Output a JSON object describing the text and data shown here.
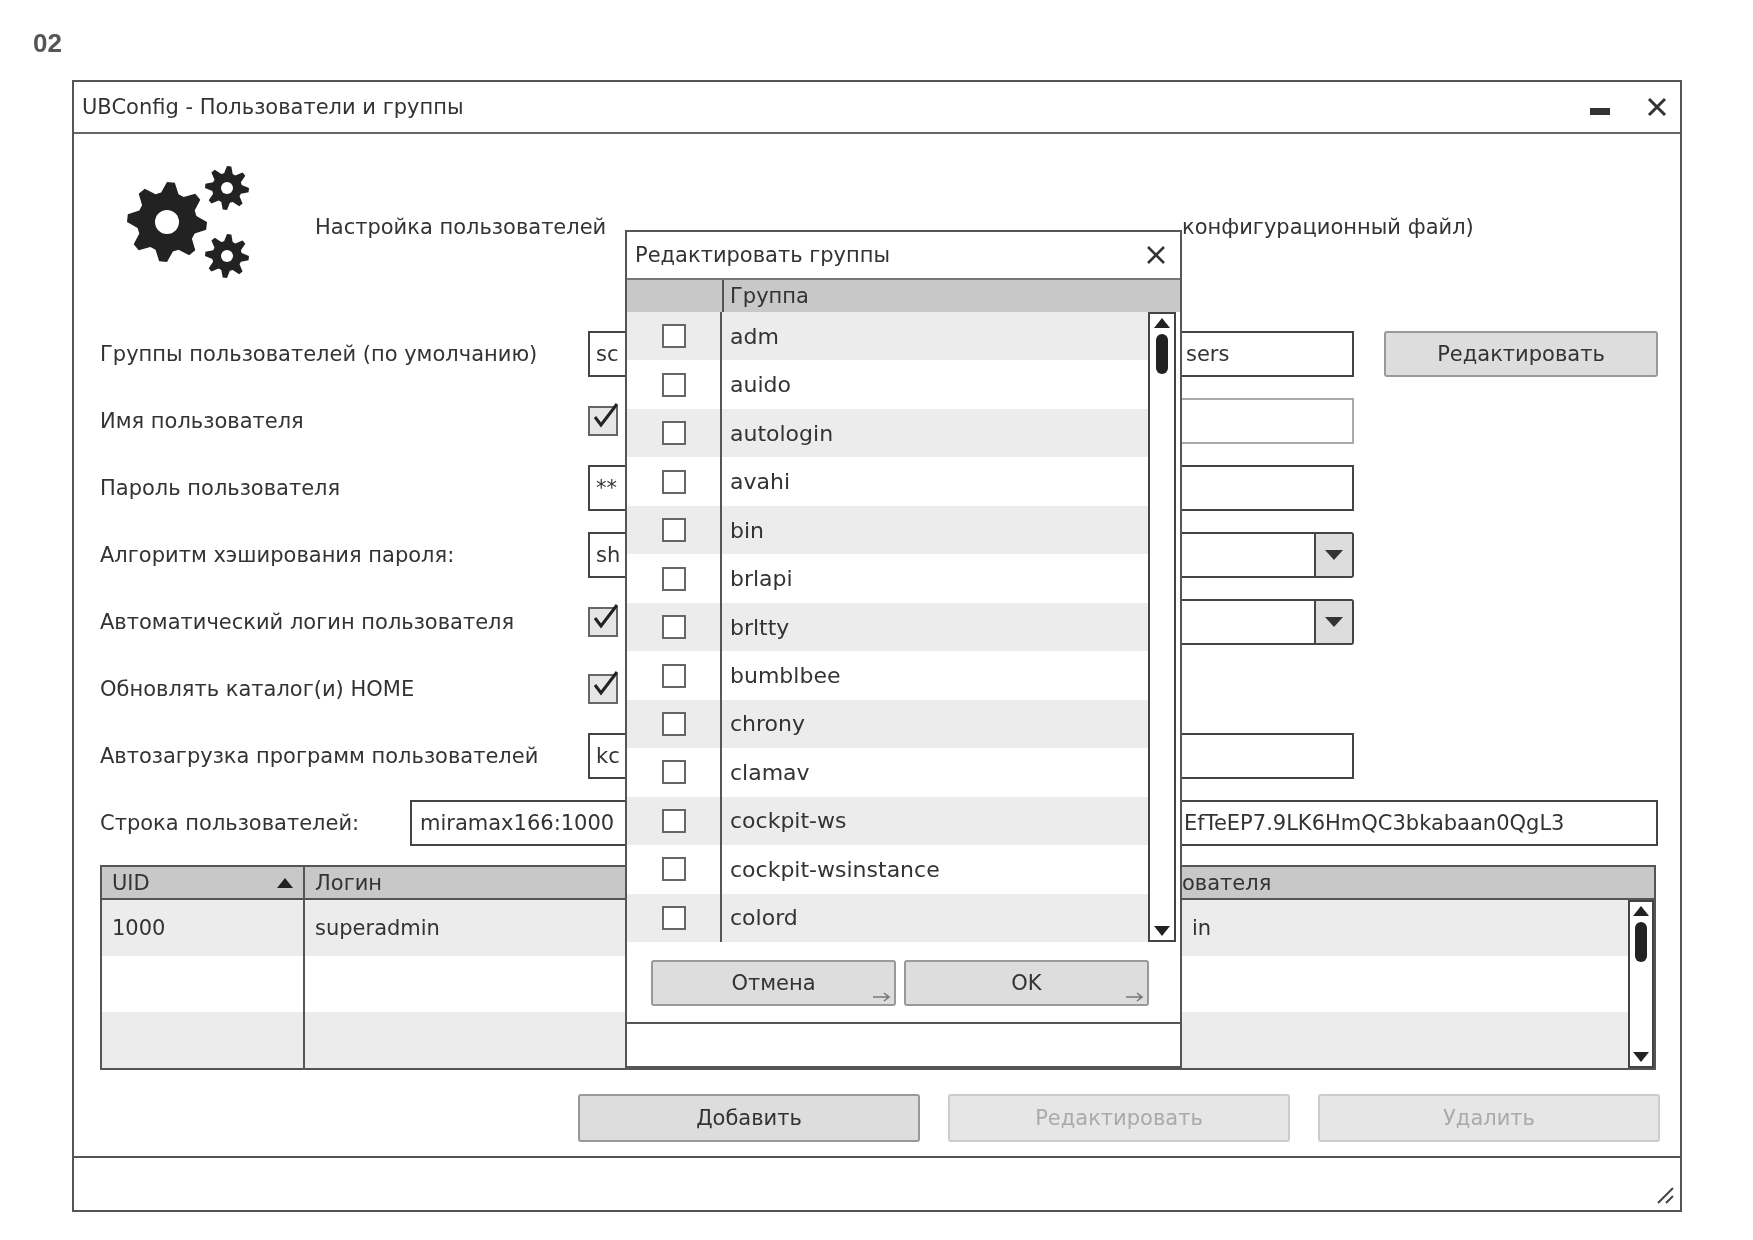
{
  "page_label": "02",
  "window": {
    "title": "UBConfig - Пользователи и группы"
  },
  "description": {
    "left": "Настройка пользователей",
    "right": "конфигурационный файл)"
  },
  "form_rows": [
    {
      "kind": "field",
      "label": "Группы пользователей (по умолчанию)",
      "value_left": "sc",
      "value_right": "sers",
      "button": "Редактировать"
    },
    {
      "kind": "check_field",
      "label": "Имя пользователя",
      "checked": true,
      "disabled": true
    },
    {
      "kind": "field",
      "label": "Пароль пользователя",
      "value_left": "**"
    },
    {
      "kind": "combo",
      "label": "Алгоритм хэширования пароля:",
      "value_left": "sh"
    },
    {
      "kind": "check_combo",
      "label": "Автоматический логин пользователя",
      "checked": true
    },
    {
      "kind": "check",
      "label": "Обновлять каталог(и) HOME",
      "checked": true
    },
    {
      "kind": "field",
      "label": "Автозагрузка программ пользователей",
      "value_left": "kc"
    }
  ],
  "user_string": {
    "label": "Строка пользователей:",
    "value_left": "miramax166:1000",
    "value_right": "EfTeEP7.9LK6HmQC3bkabaan0QgL3"
  },
  "table": {
    "columns": [
      {
        "label": "UID",
        "sorted": true
      },
      {
        "label": "Логин",
        "sorted": false
      },
      {
        "label": "ователя",
        "sorted": false
      }
    ],
    "rows": [
      {
        "cells": [
          "1000",
          "superadmin",
          "in"
        ]
      }
    ]
  },
  "buttons": [
    {
      "label": "Добавить",
      "disabled": false
    },
    {
      "label": "Редактировать",
      "disabled": true
    },
    {
      "label": "Удалить",
      "disabled": true
    }
  ],
  "dialog": {
    "title": "Редактировать группы",
    "column": "Группа",
    "groups": [
      {
        "name": "adm",
        "checked": false
      },
      {
        "name": "auido",
        "checked": false
      },
      {
        "name": "autologin",
        "checked": false
      },
      {
        "name": "avahi",
        "checked": false
      },
      {
        "name": "bin",
        "checked": false
      },
      {
        "name": "brlapi",
        "checked": false
      },
      {
        "name": "brltty",
        "checked": false
      },
      {
        "name": "bumblbee",
        "checked": false
      },
      {
        "name": "chrony",
        "checked": false
      },
      {
        "name": "clamav",
        "checked": false
      },
      {
        "name": "cockpit-ws",
        "checked": false
      },
      {
        "name": "cockpit-wsinstance",
        "checked": false
      },
      {
        "name": "colord",
        "checked": false
      }
    ],
    "buttons": [
      "Отмена",
      "OK"
    ]
  }
}
